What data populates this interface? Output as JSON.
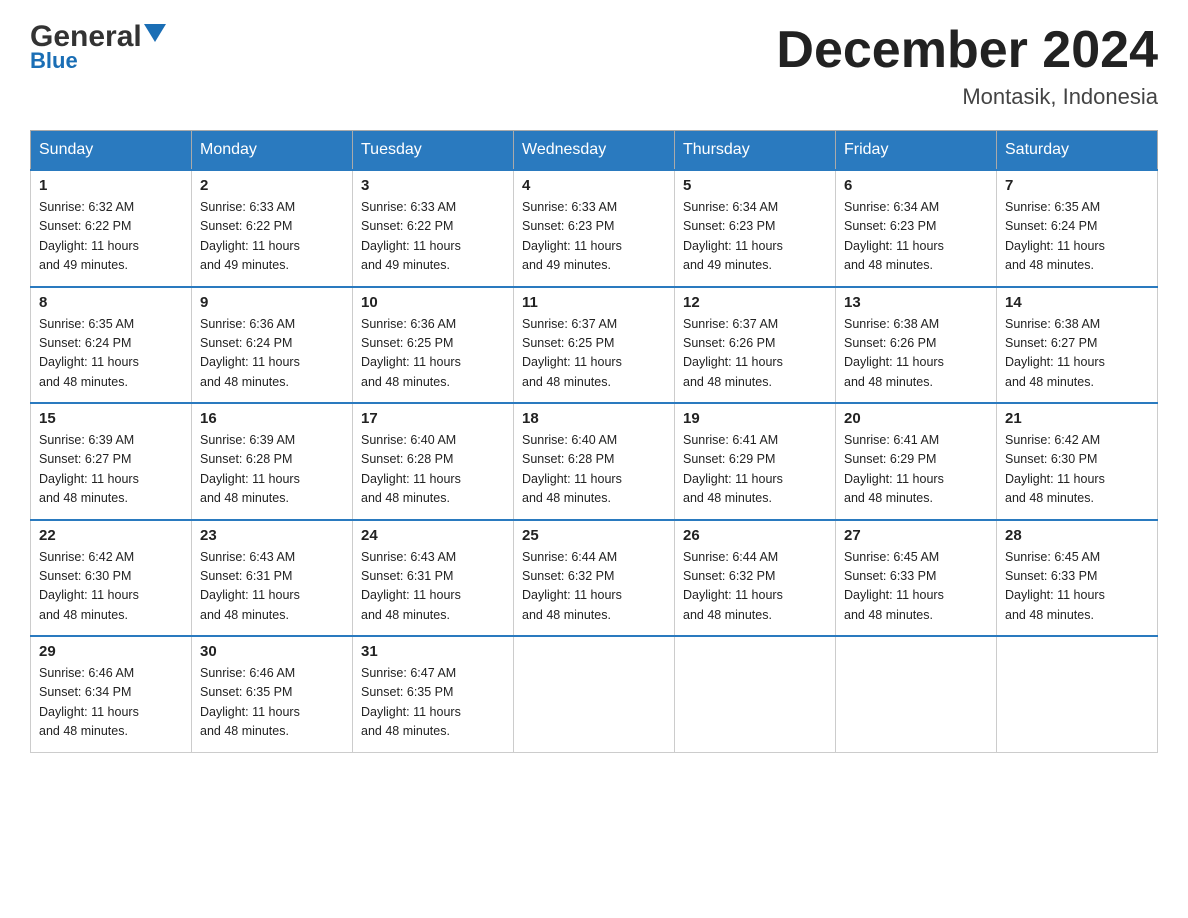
{
  "header": {
    "logo_main": "General",
    "logo_triangle_char": "▼",
    "logo_sub": "Blue",
    "title": "December 2024",
    "location": "Montasik, Indonesia"
  },
  "calendar": {
    "days_of_week": [
      "Sunday",
      "Monday",
      "Tuesday",
      "Wednesday",
      "Thursday",
      "Friday",
      "Saturday"
    ],
    "weeks": [
      [
        {
          "day": "1",
          "sunrise": "6:32 AM",
          "sunset": "6:22 PM",
          "daylight": "11 hours and 49 minutes."
        },
        {
          "day": "2",
          "sunrise": "6:33 AM",
          "sunset": "6:22 PM",
          "daylight": "11 hours and 49 minutes."
        },
        {
          "day": "3",
          "sunrise": "6:33 AM",
          "sunset": "6:22 PM",
          "daylight": "11 hours and 49 minutes."
        },
        {
          "day": "4",
          "sunrise": "6:33 AM",
          "sunset": "6:23 PM",
          "daylight": "11 hours and 49 minutes."
        },
        {
          "day": "5",
          "sunrise": "6:34 AM",
          "sunset": "6:23 PM",
          "daylight": "11 hours and 49 minutes."
        },
        {
          "day": "6",
          "sunrise": "6:34 AM",
          "sunset": "6:23 PM",
          "daylight": "11 hours and 48 minutes."
        },
        {
          "day": "7",
          "sunrise": "6:35 AM",
          "sunset": "6:24 PM",
          "daylight": "11 hours and 48 minutes."
        }
      ],
      [
        {
          "day": "8",
          "sunrise": "6:35 AM",
          "sunset": "6:24 PM",
          "daylight": "11 hours and 48 minutes."
        },
        {
          "day": "9",
          "sunrise": "6:36 AM",
          "sunset": "6:24 PM",
          "daylight": "11 hours and 48 minutes."
        },
        {
          "day": "10",
          "sunrise": "6:36 AM",
          "sunset": "6:25 PM",
          "daylight": "11 hours and 48 minutes."
        },
        {
          "day": "11",
          "sunrise": "6:37 AM",
          "sunset": "6:25 PM",
          "daylight": "11 hours and 48 minutes."
        },
        {
          "day": "12",
          "sunrise": "6:37 AM",
          "sunset": "6:26 PM",
          "daylight": "11 hours and 48 minutes."
        },
        {
          "day": "13",
          "sunrise": "6:38 AM",
          "sunset": "6:26 PM",
          "daylight": "11 hours and 48 minutes."
        },
        {
          "day": "14",
          "sunrise": "6:38 AM",
          "sunset": "6:27 PM",
          "daylight": "11 hours and 48 minutes."
        }
      ],
      [
        {
          "day": "15",
          "sunrise": "6:39 AM",
          "sunset": "6:27 PM",
          "daylight": "11 hours and 48 minutes."
        },
        {
          "day": "16",
          "sunrise": "6:39 AM",
          "sunset": "6:28 PM",
          "daylight": "11 hours and 48 minutes."
        },
        {
          "day": "17",
          "sunrise": "6:40 AM",
          "sunset": "6:28 PM",
          "daylight": "11 hours and 48 minutes."
        },
        {
          "day": "18",
          "sunrise": "6:40 AM",
          "sunset": "6:28 PM",
          "daylight": "11 hours and 48 minutes."
        },
        {
          "day": "19",
          "sunrise": "6:41 AM",
          "sunset": "6:29 PM",
          "daylight": "11 hours and 48 minutes."
        },
        {
          "day": "20",
          "sunrise": "6:41 AM",
          "sunset": "6:29 PM",
          "daylight": "11 hours and 48 minutes."
        },
        {
          "day": "21",
          "sunrise": "6:42 AM",
          "sunset": "6:30 PM",
          "daylight": "11 hours and 48 minutes."
        }
      ],
      [
        {
          "day": "22",
          "sunrise": "6:42 AM",
          "sunset": "6:30 PM",
          "daylight": "11 hours and 48 minutes."
        },
        {
          "day": "23",
          "sunrise": "6:43 AM",
          "sunset": "6:31 PM",
          "daylight": "11 hours and 48 minutes."
        },
        {
          "day": "24",
          "sunrise": "6:43 AM",
          "sunset": "6:31 PM",
          "daylight": "11 hours and 48 minutes."
        },
        {
          "day": "25",
          "sunrise": "6:44 AM",
          "sunset": "6:32 PM",
          "daylight": "11 hours and 48 minutes."
        },
        {
          "day": "26",
          "sunrise": "6:44 AM",
          "sunset": "6:32 PM",
          "daylight": "11 hours and 48 minutes."
        },
        {
          "day": "27",
          "sunrise": "6:45 AM",
          "sunset": "6:33 PM",
          "daylight": "11 hours and 48 minutes."
        },
        {
          "day": "28",
          "sunrise": "6:45 AM",
          "sunset": "6:33 PM",
          "daylight": "11 hours and 48 minutes."
        }
      ],
      [
        {
          "day": "29",
          "sunrise": "6:46 AM",
          "sunset": "6:34 PM",
          "daylight": "11 hours and 48 minutes."
        },
        {
          "day": "30",
          "sunrise": "6:46 AM",
          "sunset": "6:35 PM",
          "daylight": "11 hours and 48 minutes."
        },
        {
          "day": "31",
          "sunrise": "6:47 AM",
          "sunset": "6:35 PM",
          "daylight": "11 hours and 48 minutes."
        },
        null,
        null,
        null,
        null
      ]
    ]
  }
}
